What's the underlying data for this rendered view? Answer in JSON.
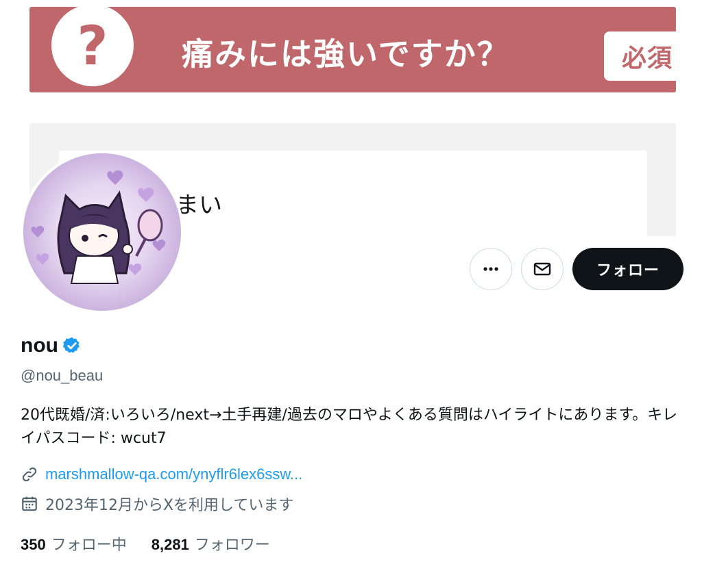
{
  "banner": {
    "question_mark": "?",
    "question": "痛みには強いですか？",
    "required_badge": "必須",
    "answer_fragment": "まい",
    "accent_color": "#c0676b"
  },
  "actions": {
    "more_icon": "more-dots-icon",
    "message_icon": "envelope-icon",
    "follow_label": "フォロー"
  },
  "profile": {
    "display_name": "nou",
    "verified_icon": "verified-badge-icon",
    "handle": "@nou_beau",
    "bio": "20代既婚/済:いろいろ/next→土手再建/過去のマロやよくある質問はハイライトにあります。キレイパスコード: wcut7",
    "link_icon": "link-icon",
    "link": "marshmallow-qa.com/ynyflr6lex6ssw...",
    "calendar_icon": "calendar-icon",
    "joined": "2023年12月からXを利用しています",
    "following_count": "350",
    "following_label": "フォロー中",
    "followers_count": "8,281",
    "followers_label": "フォロワー",
    "link_color": "#1d9bf0"
  }
}
